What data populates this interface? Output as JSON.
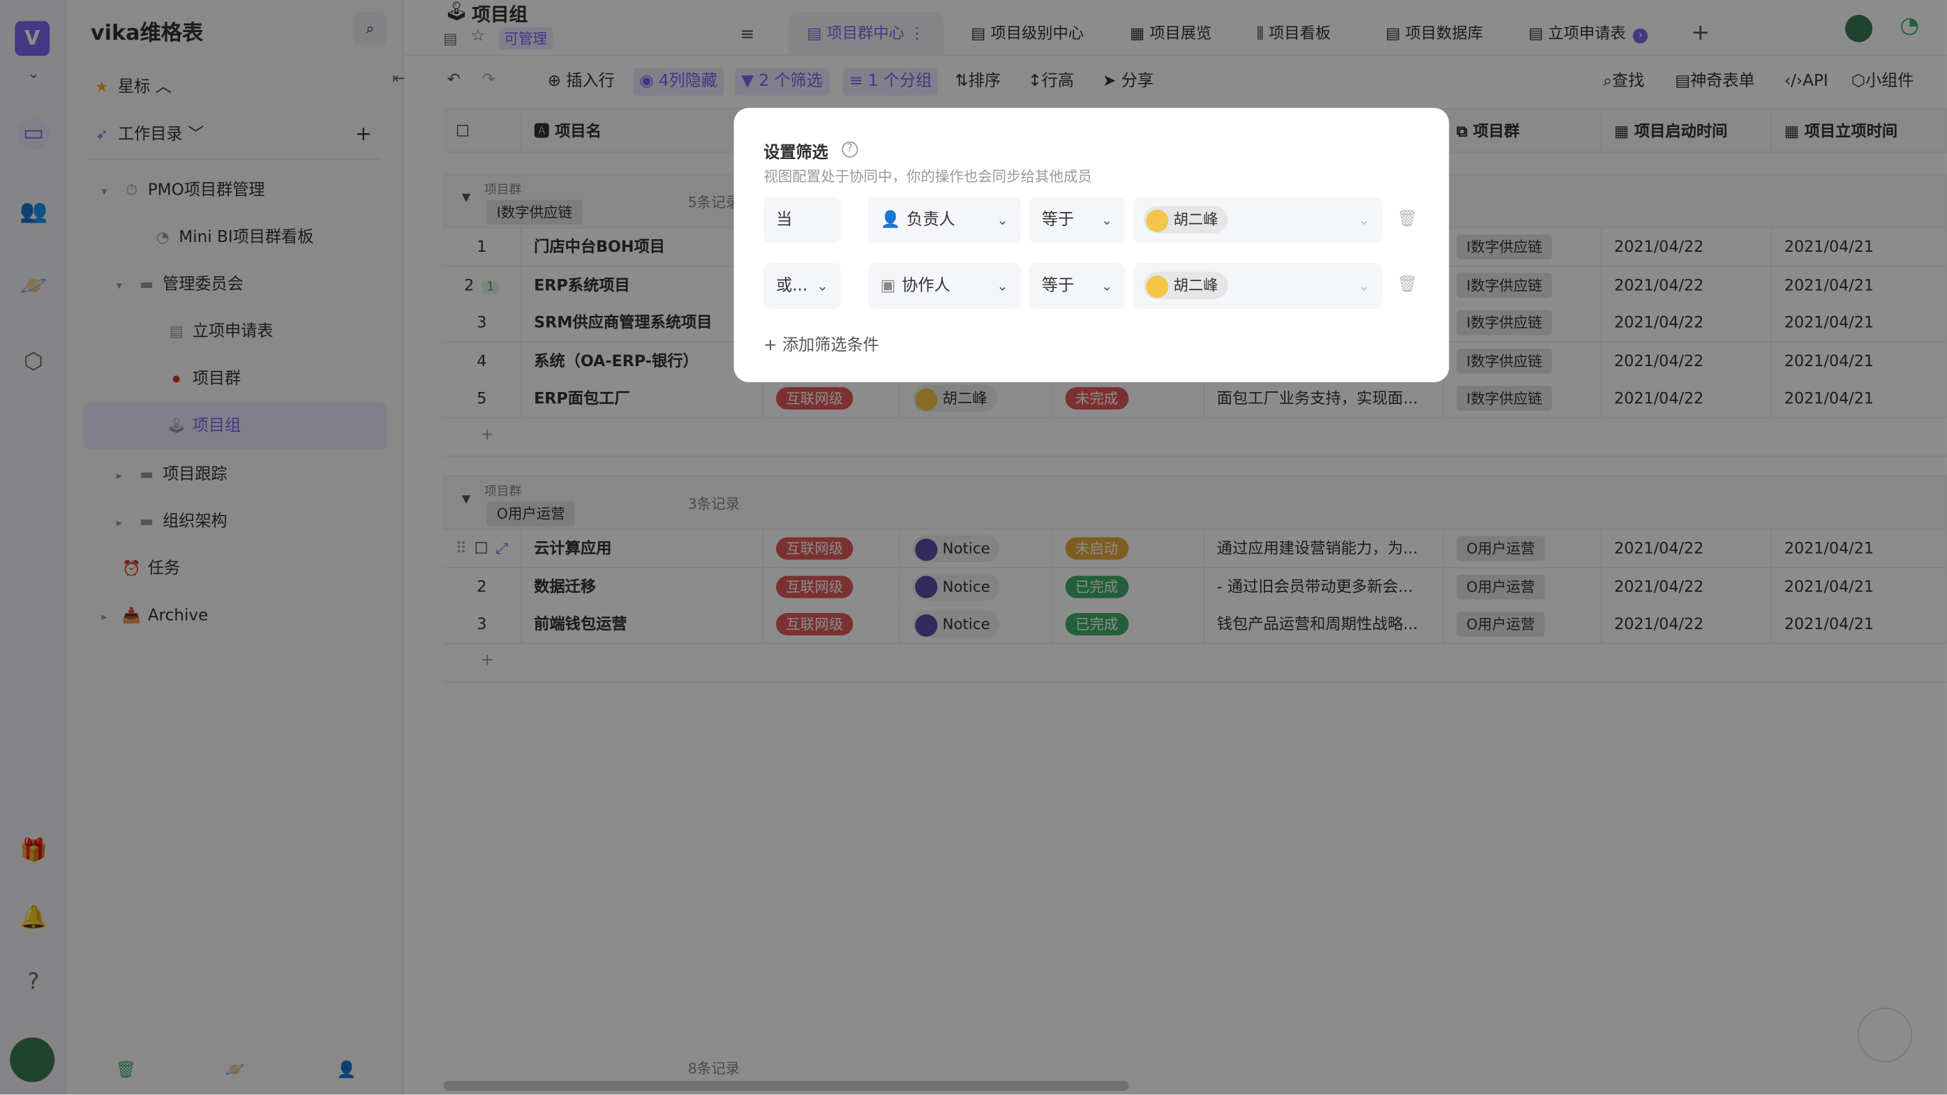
{
  "app": {
    "brand": "vika维格表",
    "accent": "#7b67ee"
  },
  "sidebar": {
    "starred": "星标",
    "workdir": "工作目录",
    "items": [
      {
        "label": "PMO项目群管理",
        "icon": "stopwatch-icon"
      },
      {
        "label": "Mini BI项目群看板",
        "icon": "dashboard-icon"
      },
      {
        "label": "管理委员会",
        "icon": "folder-icon"
      },
      {
        "label": "立项申请表",
        "icon": "form-icon"
      },
      {
        "label": "项目群",
        "icon": "record-icon"
      },
      {
        "label": "项目组",
        "icon": "joystick-icon",
        "selected": true
      },
      {
        "label": "项目跟踪",
        "icon": "folder-icon"
      },
      {
        "label": "组织架构",
        "icon": "folder-icon"
      },
      {
        "label": "任务",
        "icon": "alarm-clock-icon"
      },
      {
        "label": "Archive",
        "icon": "inbox-icon"
      }
    ]
  },
  "header": {
    "title": "项目组",
    "permission": "可管理",
    "tabs": [
      "项目群中心",
      "项目级别中心",
      "项目展览",
      "项目看板",
      "项目数据库",
      "立项申请表"
    ]
  },
  "toolbar": {
    "insert": "插入行",
    "hidden": "4列隐藏",
    "filter": "2 个筛选",
    "group": "1 个分组",
    "sort": "排序",
    "row_height": "行高",
    "share": "分享",
    "find": "查找",
    "form": "神奇表单",
    "api": "API",
    "widget": "小组件"
  },
  "grid": {
    "columns": {
      "name": "项目名",
      "group": "项目群",
      "start": "项目启动时间",
      "approve": "项目立项时间"
    },
    "group_label": "项目群",
    "groups": [
      {
        "tag": "I数字供应链",
        "count": "5条记录",
        "rows": [
          {
            "no": "1",
            "name": "门店中台BOH项目",
            "group": "I数字供应链",
            "start": "2021/04/22",
            "approve": "2021/04/21"
          },
          {
            "no": "2",
            "comments": "1",
            "name": "ERP系统项目",
            "group": "I数字供应链",
            "start": "2021/04/22",
            "approve": "2021/04/21"
          },
          {
            "no": "3",
            "name": "SRM供应商管理系统项目",
            "group": "I数字供应链",
            "start": "2021/04/22",
            "approve": "2021/04/21"
          },
          {
            "no": "4",
            "name": "系统（OA-ERP-银行）",
            "group": "I数字供应链",
            "start": "2021/04/22",
            "approve": "2021/04/21"
          },
          {
            "no": "5",
            "name": "ERP面包工厂",
            "level": "互联网级",
            "owner": "胡二峰",
            "status": "未完成",
            "status_color": "#e05a5a",
            "desc": "面包工厂业务支持，实现面...",
            "group": "I数字供应链",
            "start": "2021/04/22",
            "approve": "2021/04/21"
          }
        ]
      },
      {
        "tag": "O用户运营",
        "count": "3条记录",
        "rows": [
          {
            "no": "",
            "name": "云计算应用",
            "level": "互联网级",
            "owner": "Notice",
            "status": "未启动",
            "status_color": "#e8a93a",
            "desc": "通过应用建设营销能力，为...",
            "group": "O用户运营",
            "start": "2021/04/22",
            "approve": "2021/04/21"
          },
          {
            "no": "2",
            "name": "数据迁移",
            "level": "互联网级",
            "owner": "Notice",
            "status": "已完成",
            "status_color": "#3fae6a",
            "desc": "- 通过旧会员带动更多新会...",
            "group": "O用户运营",
            "start": "2021/04/22",
            "approve": "2021/04/21"
          },
          {
            "no": "3",
            "name": "前端钱包运营",
            "level": "互联网级",
            "owner": "Notice",
            "status": "已完成",
            "status_color": "#3fae6a",
            "desc": "钱包产品运营和周期性战略...",
            "group": "O用户运营",
            "start": "2021/04/22",
            "approve": "2021/04/21"
          }
        ]
      }
    ],
    "total": "8条记录"
  },
  "filter_modal": {
    "title": "设置筛选",
    "subtitle": "视图配置处于协同中，你的操作也会同步给其他成员",
    "conditions": [
      {
        "conj": "当",
        "field": "负责人",
        "op": "等于",
        "value": "胡二峰"
      },
      {
        "conj": "或...",
        "field": "协作人",
        "op": "等于",
        "value": "胡二峰"
      }
    ],
    "add": "添加筛选条件"
  }
}
